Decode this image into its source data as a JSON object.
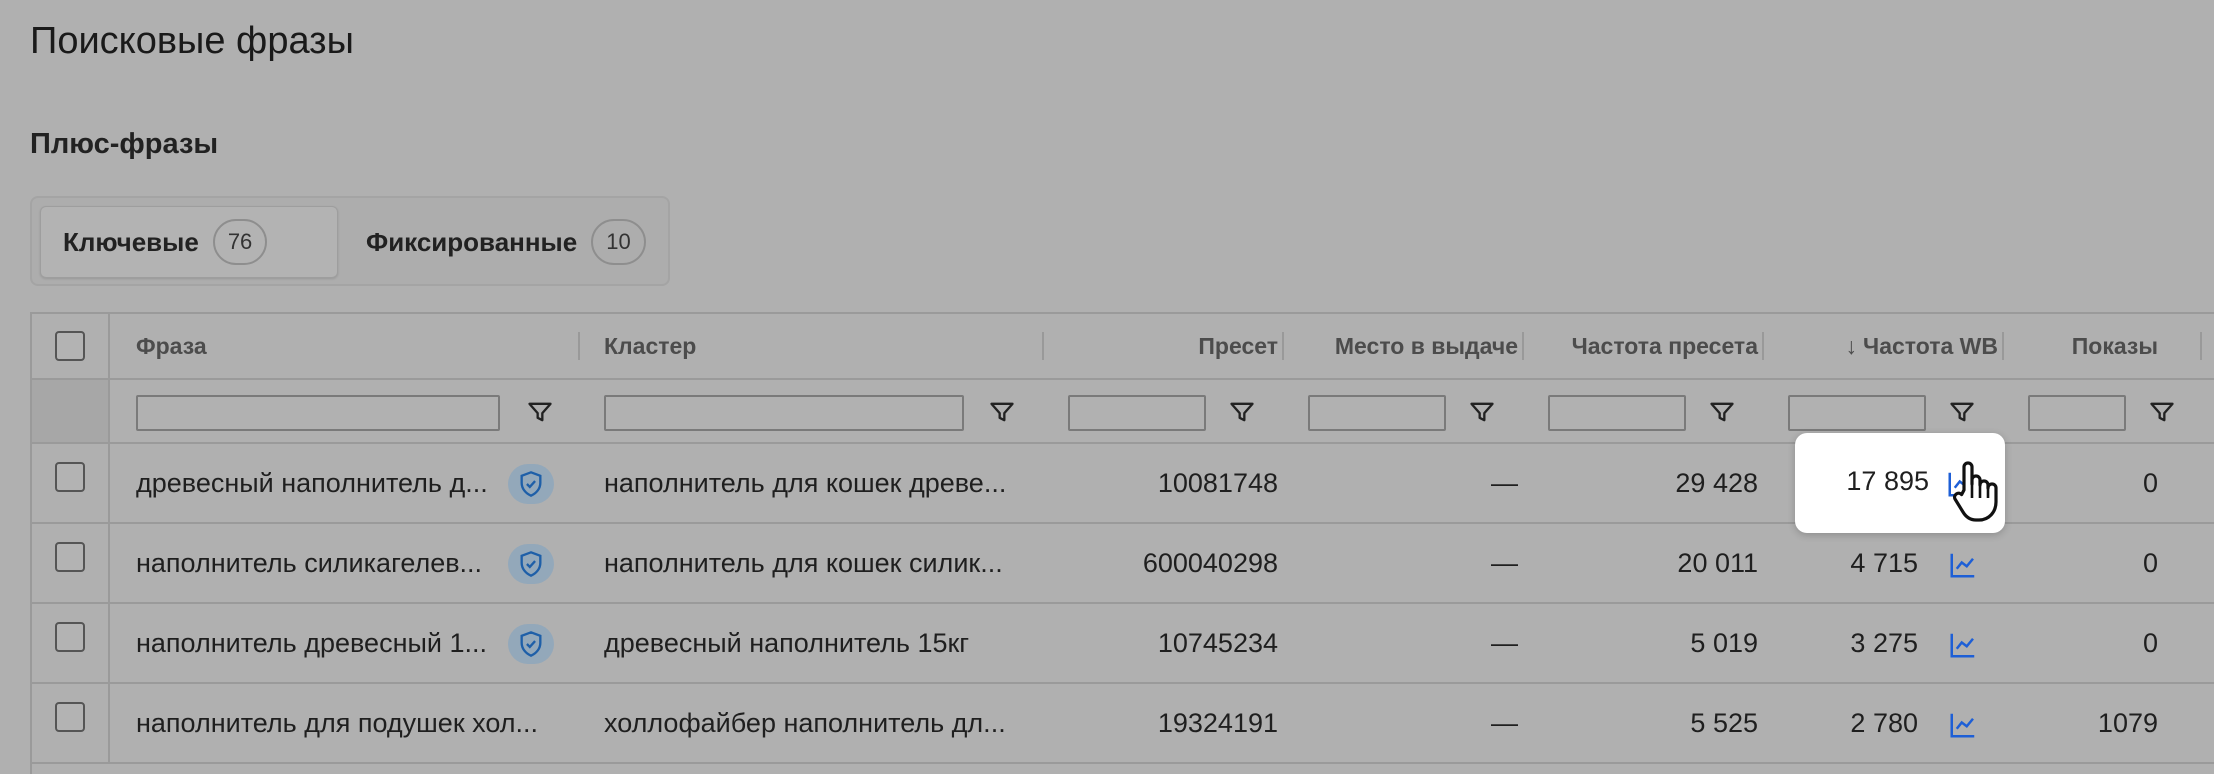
{
  "page": {
    "title": "Поисковые фразы"
  },
  "section": {
    "title": "Плюс-фразы"
  },
  "tabs": [
    {
      "label": "Ключевые",
      "count": "76",
      "active": true
    },
    {
      "label": "Фиксированные",
      "count": "10",
      "active": false
    }
  ],
  "table": {
    "columns": {
      "phrase": "Фраза",
      "cluster": "Кластер",
      "preset": "Пресет",
      "position": "Место в выдаче",
      "preset_freq": "Частота пресета",
      "wb_freq": "Частота WB",
      "wb_sort_arrow": "↓",
      "shows": "Показы"
    },
    "rows": [
      {
        "phrase": "древесный наполнитель д...",
        "cluster": "наполнитель для кошек древе...",
        "preset": "10081748",
        "position": "—",
        "preset_freq": "29 428",
        "wb_freq": "17 895",
        "shows": "0",
        "protected": true
      },
      {
        "phrase": "наполнитель силикагелев...",
        "cluster": "наполнитель для кошек силик...",
        "preset": "600040298",
        "position": "—",
        "preset_freq": "20 011",
        "wb_freq": "4 715",
        "shows": "0",
        "protected": true
      },
      {
        "phrase": "наполнитель древесный 1...",
        "cluster": "древесный наполнитель 15кг",
        "preset": "10745234",
        "position": "—",
        "preset_freq": "5 019",
        "wb_freq": "3 275",
        "shows": "0",
        "protected": true
      },
      {
        "phrase": "наполнитель для подушек хол...",
        "cluster": "холлофайбер наполнитель дл...",
        "preset": "19324191",
        "position": "—",
        "preset_freq": "5 525",
        "wb_freq": "2 780",
        "shows": "1079",
        "protected": false
      }
    ]
  },
  "icons": {
    "filter": "filter-icon",
    "shield": "shield-check-icon",
    "chart": "line-chart-icon",
    "cursor": "hand-pointer-icon"
  },
  "colors": {
    "overlay": "#b0b0b0",
    "accent": "#1e5fd6",
    "shield_bg": "#93a8ba",
    "shield_fg": "#1e5fa8"
  }
}
